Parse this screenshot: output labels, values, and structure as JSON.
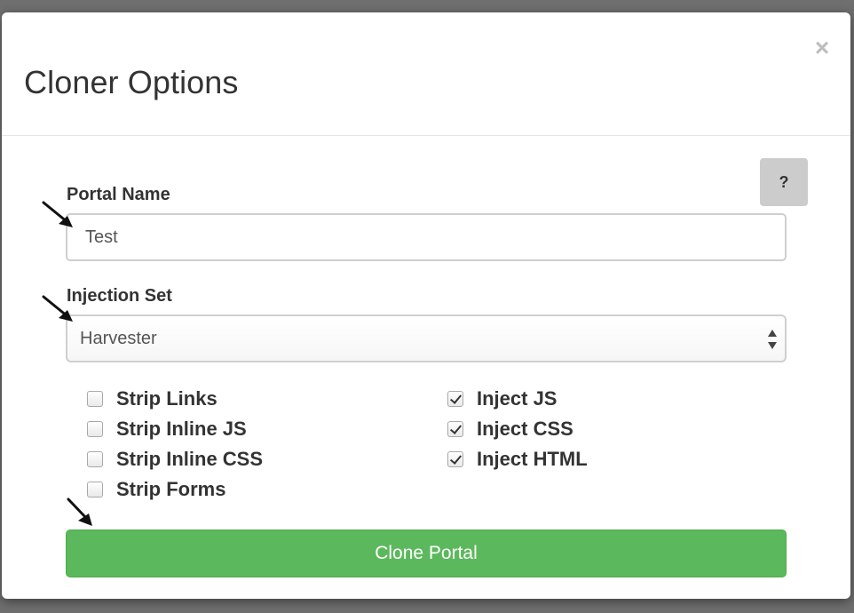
{
  "modal": {
    "title": "Cloner Options",
    "close_label": "×",
    "help_label": "?"
  },
  "form": {
    "portal_name_label": "Portal Name",
    "portal_name_value": "Test",
    "injection_set_label": "Injection Set",
    "injection_set_value": "Harvester",
    "options_left": [
      {
        "label": "Strip Links",
        "checked": false
      },
      {
        "label": "Strip Inline JS",
        "checked": false
      },
      {
        "label": "Strip Inline CSS",
        "checked": false
      },
      {
        "label": "Strip Forms",
        "checked": false
      }
    ],
    "options_right": [
      {
        "label": "Inject JS",
        "checked": true
      },
      {
        "label": "Inject CSS",
        "checked": true
      },
      {
        "label": "Inject HTML",
        "checked": true
      }
    ],
    "submit_label": "Clone Portal"
  },
  "colors": {
    "primary_button": "#5cb85c",
    "help_button": "#cccccc",
    "backdrop": "#6f6f6f"
  }
}
